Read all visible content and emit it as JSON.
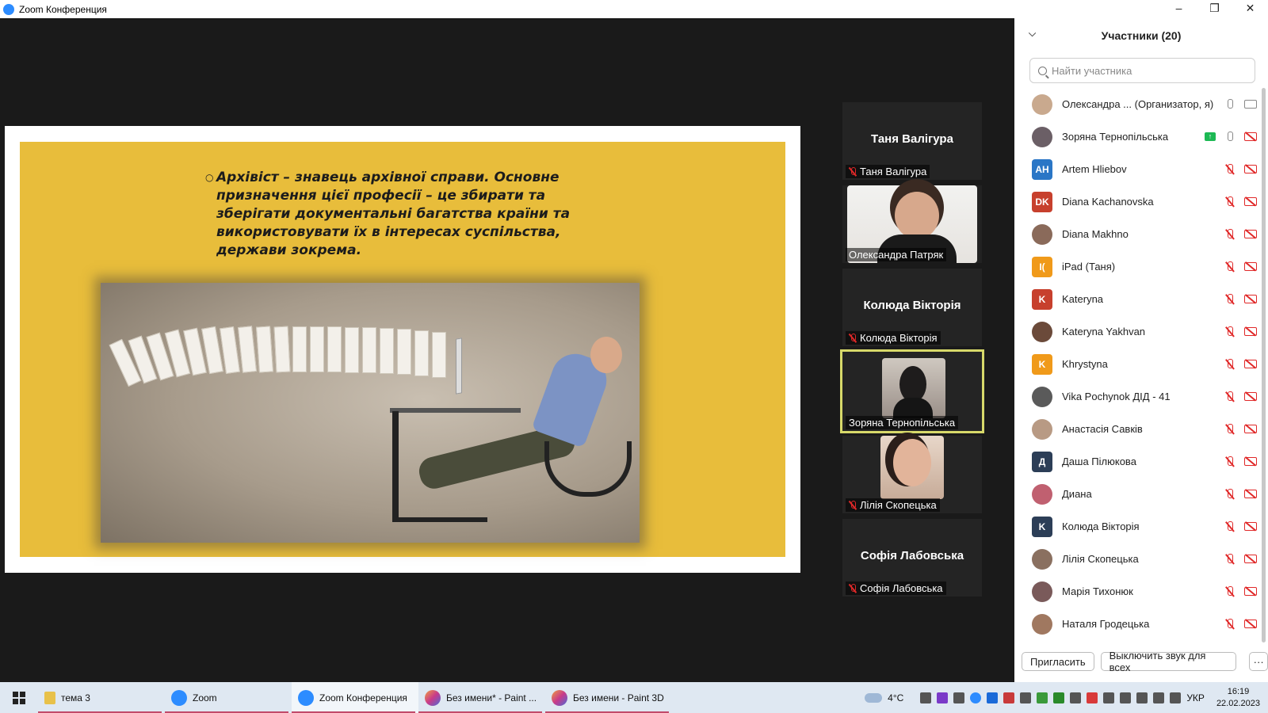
{
  "window": {
    "title": "Zoom Конференция",
    "controls": [
      "–",
      "❐",
      "✕"
    ]
  },
  "slide": {
    "text": "Архівіст – знавець архівної справи. Основне призначення цієї професії – це збирати та зберігати документальні багатства країни та використовувати їх в інтересах суспільства, держави зокрема."
  },
  "tiles": [
    {
      "big": "Таня Валігура",
      "name": "Таня Валігура"
    },
    {
      "big": "",
      "name": "Олександра Патряк"
    },
    {
      "big": "Колюда Вікторія",
      "name": "Колюда Вікторія"
    },
    {
      "big": "",
      "name": "Зоряна Тернопільська"
    },
    {
      "big": "",
      "name": "Лілія Скопецька"
    },
    {
      "big": "Софія Лабовська",
      "name": "Софія Лабовська"
    }
  ],
  "panel": {
    "title": "Участники (20)",
    "search_placeholder": "Найти участника",
    "participants": [
      {
        "name": "Олександра ... (Организатор, я)",
        "initials": "",
        "color": "#c9a98e",
        "mic": "on",
        "cam": "on",
        "share": false
      },
      {
        "name": "Зоряна Тернопільська",
        "initials": "",
        "color": "#6b5f66",
        "mic": "on",
        "cam": "off",
        "share": true
      },
      {
        "name": "Artem Hliebov",
        "initials": "AH",
        "color": "#2a76c6",
        "mic": "off",
        "cam": "off",
        "share": false
      },
      {
        "name": "Diana Kachanovska",
        "initials": "DK",
        "color": "#c7402d",
        "mic": "off",
        "cam": "off",
        "share": false
      },
      {
        "name": "Diana Makhno",
        "initials": "",
        "color": "#8a6a5a",
        "mic": "off",
        "cam": "off",
        "share": false
      },
      {
        "name": "iPad (Таня)",
        "initials": "I(",
        "color": "#f09a1a",
        "mic": "off",
        "cam": "off",
        "share": false
      },
      {
        "name": "Kateryna",
        "initials": "K",
        "color": "#c7402d",
        "mic": "off",
        "cam": "off",
        "share": false
      },
      {
        "name": "Kateryna Yakhvan",
        "initials": "",
        "color": "#6b4a3a",
        "mic": "off",
        "cam": "off",
        "share": false
      },
      {
        "name": "Khrystyna",
        "initials": "K",
        "color": "#f09a1a",
        "mic": "off",
        "cam": "off",
        "share": false
      },
      {
        "name": "Vika Pochynok ДІД - 41",
        "initials": "",
        "color": "#5a5a5a",
        "mic": "off",
        "cam": "off",
        "share": false
      },
      {
        "name": "Анастасія Савків",
        "initials": "",
        "color": "#b89a84",
        "mic": "off",
        "cam": "off",
        "share": false
      },
      {
        "name": "Даша Пілюкова",
        "initials": "Д",
        "color": "#2c3e57",
        "mic": "off",
        "cam": "off",
        "share": false
      },
      {
        "name": "Диана",
        "initials": "",
        "color": "#c06070",
        "mic": "off",
        "cam": "off",
        "share": false
      },
      {
        "name": "Колюда Вікторія",
        "initials": "K",
        "color": "#2c3e57",
        "mic": "off",
        "cam": "off",
        "share": false
      },
      {
        "name": "Лілія Скопецька",
        "initials": "",
        "color": "#8a7060",
        "mic": "off",
        "cam": "off",
        "share": false
      },
      {
        "name": "Марія Тихонюк",
        "initials": "",
        "color": "#7a5a5a",
        "mic": "off",
        "cam": "off",
        "share": false
      },
      {
        "name": "Наталя Гродецька",
        "initials": "",
        "color": "#a07860",
        "mic": "off",
        "cam": "off",
        "share": false
      }
    ],
    "invite_label": "Пригласить",
    "mute_all_label": "Выключить звук для всех",
    "more_label": "···"
  },
  "taskbar": {
    "tasks": [
      {
        "label": "тема 3",
        "color": "#e8c14a"
      },
      {
        "label": "Zoom",
        "color": "#2d8cff"
      },
      {
        "label": "Zoom Конференция",
        "color": "#2d8cff"
      },
      {
        "label": "Без имени* - Paint ...",
        "color": "#d84a7a"
      },
      {
        "label": "Без имени - Paint 3D",
        "color": "#d84a7a"
      }
    ],
    "weather": "4°C",
    "lang": "УКР",
    "time": "16:19",
    "date": "22.02.2023"
  }
}
